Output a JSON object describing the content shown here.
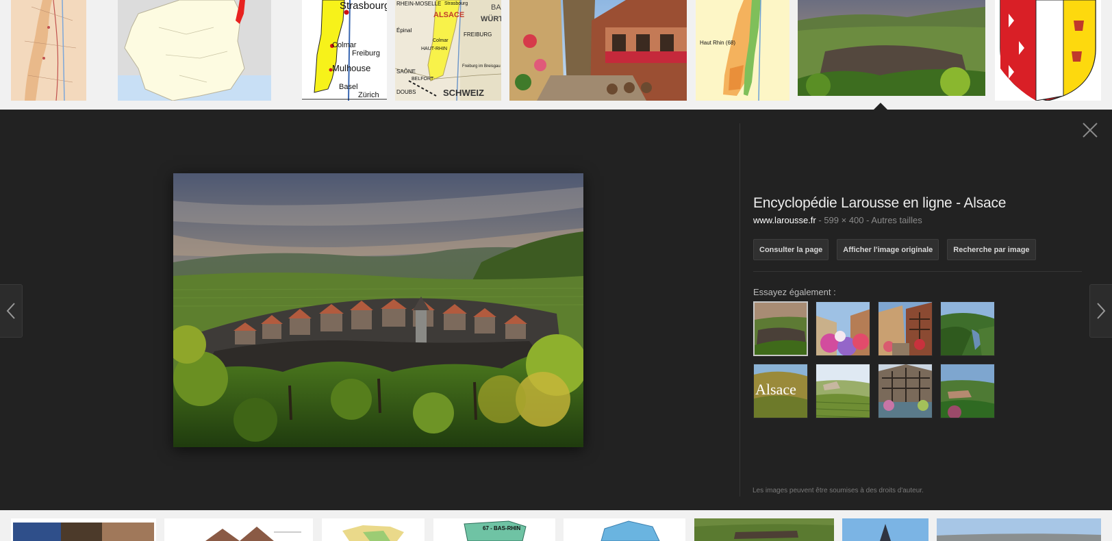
{
  "top_strip": {
    "thumbs": [
      {
        "name": "alsace-relief-map"
      },
      {
        "name": "france-locator-map"
      },
      {
        "name": "alsace-yellow-road-map",
        "labels": [
          "Strasbourg",
          "Colmar",
          "Freiburg",
          "Mulhouse",
          "Basel",
          "Zürich"
        ]
      },
      {
        "name": "alsace-political-map",
        "labels": [
          "RHEIN-MOSELLE",
          "ALSACE",
          "WÜRT",
          "FREIBURG",
          "HAUT-RHIN",
          "SCHWEIZ",
          "SAÔNE",
          "BELFORT",
          "Épinal",
          "DOUBS",
          "Colmar",
          "Freiburg im Breisgau",
          "Strasbourg",
          "BA"
        ]
      },
      {
        "name": "alsace-village-street-photo"
      },
      {
        "name": "haut-rhin-map",
        "labels": [
          "Haut Rhin (68)"
        ]
      },
      {
        "name": "alsace-village-vineyard-photo",
        "selected": true
      },
      {
        "name": "alsace-coat-of-arms"
      }
    ]
  },
  "preview": {
    "title": "Encyclopédie Larousse en ligne - Alsace",
    "site": "www.larousse.fr",
    "separator": " - ",
    "dimensions": "599 × 400",
    "separator2": " - ",
    "other_sizes": "Autres tailles",
    "buttons": {
      "visit": "Consulter la page",
      "view_original": "Afficher l'image originale",
      "search_by_image": "Recherche par image"
    },
    "also_try_label": "Essayez également :",
    "also_try": [
      {
        "name": "riquewihr-vineyard",
        "selected": true
      },
      {
        "name": "colmar-flowers-street"
      },
      {
        "name": "half-timbered-houses"
      },
      {
        "name": "vosges-valley"
      },
      {
        "name": "alsace-book-cover",
        "text": "Alsace"
      },
      {
        "name": "vineyard-hills"
      },
      {
        "name": "petite-france-canal"
      },
      {
        "name": "wine-route-panorama"
      }
    ],
    "copyright": "Les images peuvent être soumises à des droits d'auteur."
  },
  "bottom_strip": {
    "thumbs": [
      {
        "name": "bottom-thumb-1"
      },
      {
        "name": "bottom-thumb-2"
      },
      {
        "name": "bottom-thumb-3"
      },
      {
        "name": "bottom-thumb-4",
        "label": "67 - BAS-RHIN"
      },
      {
        "name": "bottom-thumb-5"
      },
      {
        "name": "bottom-thumb-6"
      },
      {
        "name": "bottom-thumb-7"
      },
      {
        "name": "bottom-thumb-8"
      }
    ]
  },
  "icons": {
    "close": "close-icon",
    "prev": "chevron-left-icon",
    "next": "chevron-right-icon"
  },
  "colors": {
    "panel_bg": "#222222",
    "strip_bg": "#f1f1f1",
    "title": "#ececec",
    "meta": "#8a8a8a"
  }
}
